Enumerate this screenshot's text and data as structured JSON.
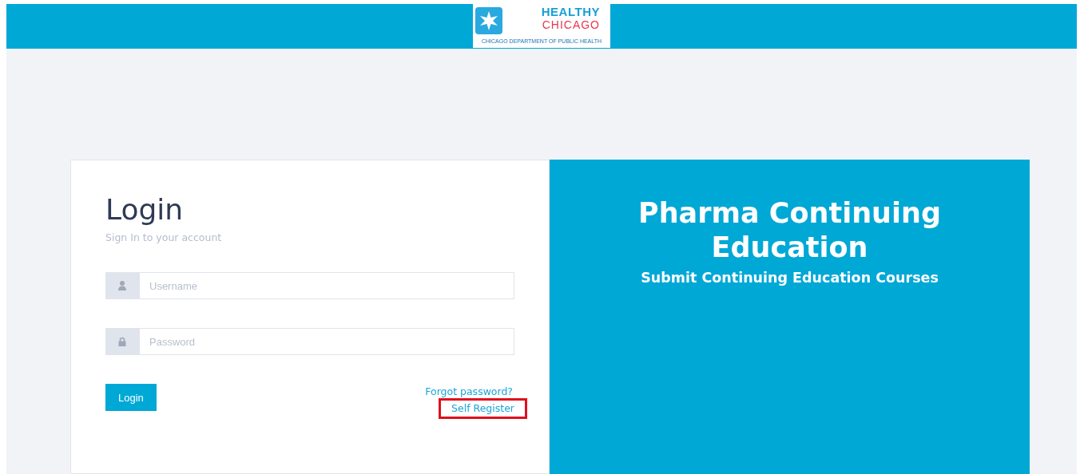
{
  "header": {
    "logo": {
      "line1": "HEALTHY",
      "line2": "CHICAGO",
      "tagline": "CHICAGO DEPARTMENT OF PUBLIC HEALTH"
    }
  },
  "login": {
    "title": "Login",
    "subtitle": "Sign In to your account",
    "fields": [
      {
        "kind": "user",
        "placeholder": "Username"
      },
      {
        "kind": "lock",
        "placeholder": "Password"
      }
    ],
    "button": "Login",
    "links": [
      {
        "label": "Forgot password?",
        "highlighted": false
      },
      {
        "label": "Self Register",
        "highlighted": true
      }
    ]
  },
  "promo": {
    "title": "Pharma Continuing Education",
    "subtitle": "Submit Continuing Education Courses"
  }
}
